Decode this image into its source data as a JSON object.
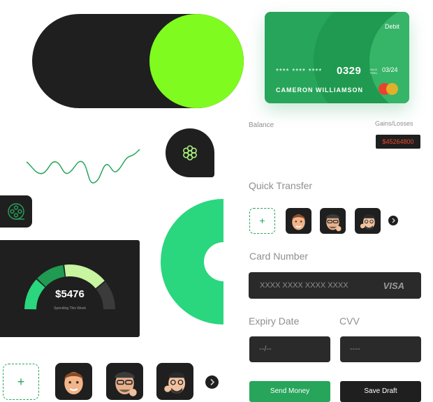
{
  "card": {
    "type": "Debit",
    "masked": "**** **** ****",
    "last4": "0329",
    "valid_thru": "VALID THRU",
    "expiry": "03/24",
    "holder": "CAMERON WILLIAMSON"
  },
  "balance": {
    "label": "Balance",
    "gains_label": "Gains/Losses",
    "gains_value": "$45264800"
  },
  "gauge": {
    "value": "$5476",
    "caption": "Spending This Week",
    "segments": [
      0.22,
      0.2,
      0.3,
      0.2
    ]
  },
  "quick_transfer": {
    "title": "Quick Transfer",
    "add_glyph": "+",
    "next_icon": "chevron-right-icon"
  },
  "card_number": {
    "label": "Card Number",
    "placeholder": "XXXX XXXX XXXX XXXX",
    "brand": "VISA"
  },
  "expiry": {
    "label": "Expiry Date",
    "placeholder": "--/--"
  },
  "cvv": {
    "label": "CVV",
    "placeholder": "----"
  },
  "actions": {
    "send": "Send Money",
    "save": "Save Draft"
  },
  "bottom_row": {
    "add_glyph": "+",
    "next_icon": "chevron-right-icon"
  },
  "colors": {
    "accent_green": "#27a55a",
    "lime": "#7ffb1f",
    "dark": "#1f1f1f",
    "danger": "#f04a2a",
    "mint": "#2ad67e"
  }
}
